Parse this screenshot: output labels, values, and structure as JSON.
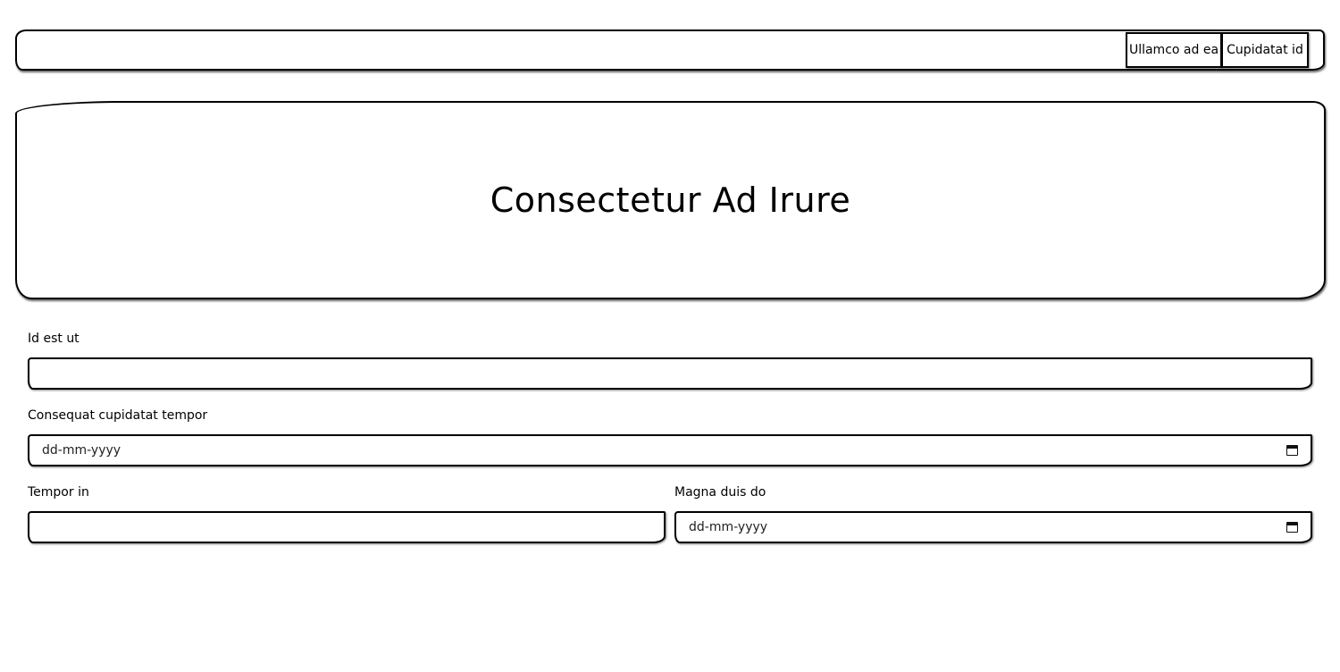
{
  "nav": {
    "items": [
      {
        "label": "Ullamco ad ea"
      },
      {
        "label": "Cupidatat id"
      }
    ]
  },
  "hero": {
    "title": "Consectetur Ad Irure"
  },
  "form": {
    "field1": {
      "label": "Id est ut",
      "value": ""
    },
    "field2": {
      "label": "Consequat cupidatat tempor",
      "placeholder": "dd-mm-yyyy"
    },
    "field3": {
      "label": "Tempor in",
      "value": ""
    },
    "field4": {
      "label": "Magna duis do",
      "placeholder": "dd-mm-yyyy"
    }
  },
  "icons": {
    "date_picker": "calendar-icon"
  }
}
